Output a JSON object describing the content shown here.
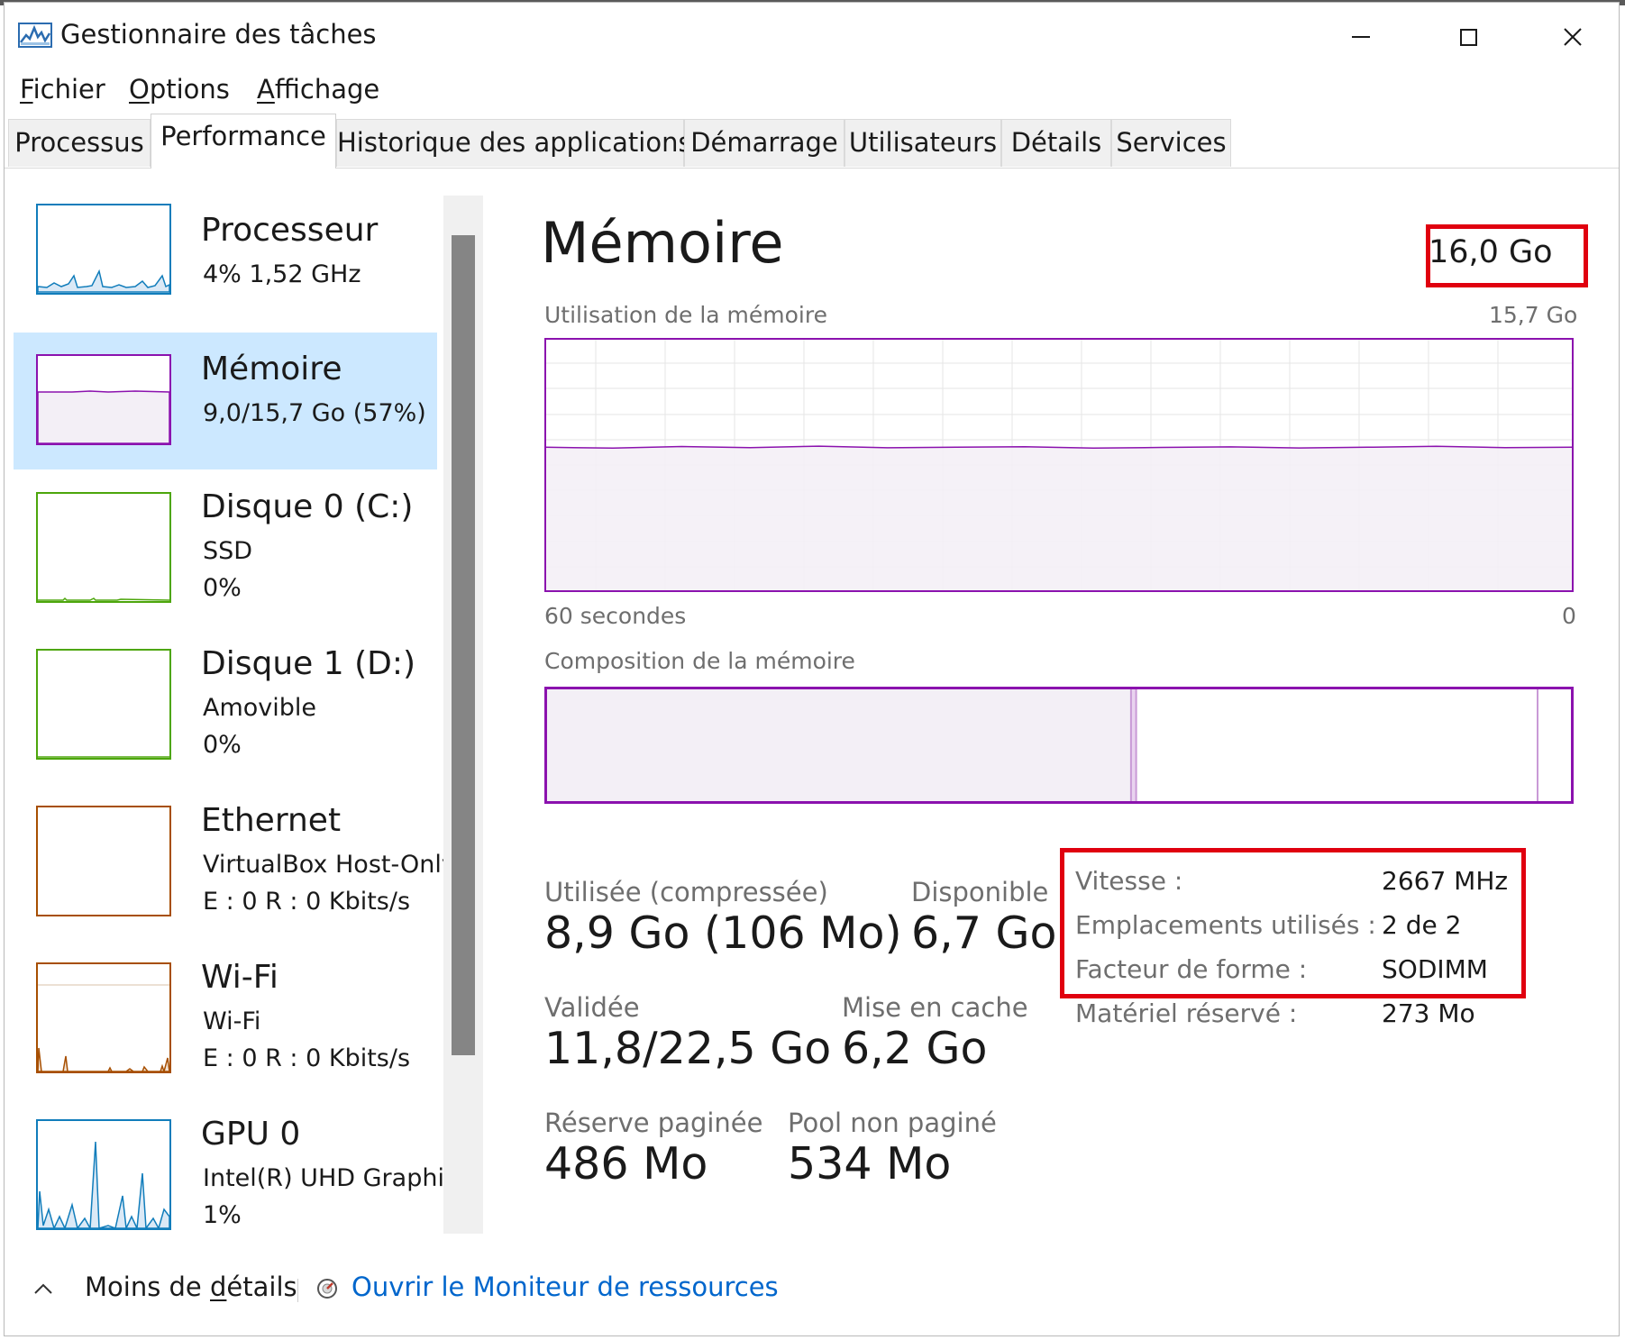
{
  "window": {
    "title": "Gestionnaire des tâches",
    "icon": "task-manager-icon",
    "controls": [
      "minimize-icon",
      "maximize-icon",
      "close-icon"
    ]
  },
  "menu": {
    "fichier": {
      "mnemonic": "F",
      "rest": "ichier"
    },
    "options": {
      "mnemonic": "O",
      "rest": "ptions"
    },
    "affichage": {
      "mnemonic": "A",
      "rest": "ffichage"
    }
  },
  "tabs": [
    "Processus",
    "Performance",
    "Historique des applications",
    "Démarrage",
    "Utilisateurs",
    "Détails",
    "Services"
  ],
  "active_tab": "Performance",
  "sidebar": {
    "items": [
      {
        "name": "Processeur",
        "line1": "4%  1,52 GHz",
        "line2": ""
      },
      {
        "name": "Mémoire",
        "line1": "9,0/15,7 Go (57%)",
        "line2": ""
      },
      {
        "name": "Disque 0 (C:)",
        "line1": "SSD",
        "line2": "0%"
      },
      {
        "name": "Disque 1 (D:)",
        "line1": "Amovible",
        "line2": "0%"
      },
      {
        "name": "Ethernet",
        "line1": "VirtualBox Host-Only",
        "line2": "E : 0  R : 0 Kbits/s"
      },
      {
        "name": "Wi-Fi",
        "line1": "Wi-Fi",
        "line2": "E : 0  R : 0 Kbits/s"
      },
      {
        "name": "GPU 0",
        "line1": "Intel(R) UHD Graphics",
        "line2": "1%"
      }
    ],
    "selected_index": 1
  },
  "main": {
    "title": "Mémoire",
    "total": "16,0 Go",
    "usage_caption": "Utilisation de la mémoire",
    "usage_max": "15,7 Go",
    "time_left": "60 secondes",
    "time_right": "0",
    "composition_caption": "Composition de la mémoire",
    "stats": {
      "used_label": "Utilisée (compressée)",
      "used_value": "8,9 Go (106 Mo)",
      "available_label": "Disponible",
      "available_value": "6,7 Go",
      "committed_label": "Validée",
      "committed_value": "11,8/22,5 Go",
      "cached_label": "Mise en cache",
      "cached_value": "6,2 Go",
      "paged_label": "Réserve paginée",
      "paged_value": "486 Mo",
      "nonpaged_label": "Pool non paginé",
      "nonpaged_value": "534 Mo"
    },
    "specs": [
      {
        "label": "Vitesse :",
        "value": "2667 MHz"
      },
      {
        "label": "Emplacements utilisés :",
        "value": "2 de 2"
      },
      {
        "label": "Facteur de forme :",
        "value": "SODIMM"
      },
      {
        "label": "Matériel réservé :",
        "value": "273 Mo"
      }
    ]
  },
  "footer": {
    "less_details_pre": "Moins de ",
    "less_details_mnemonic": "d",
    "less_details_post": "étails",
    "resmon_link": "Ouvrir le Moniteur de ressources"
  },
  "chart_data": {
    "type": "area",
    "title": "Utilisation de la mémoire",
    "xlabel": "",
    "ylabel": "",
    "x_range_labels": [
      "60 secondes",
      "0"
    ],
    "y_max_label": "15,7 Go",
    "usage_fraction": 0.57,
    "composition_fractions": {
      "in_use": 0.57,
      "modified": 0.005,
      "standby": 0.39,
      "free": 0.03
    }
  },
  "colors": {
    "memory": "#8b12ae",
    "memory_fill": "#f3eff6",
    "cpu": "#117dbb",
    "disk": "#4da60c",
    "ethernet": "#a74f01",
    "wifi": "#a74f01",
    "gpu": "#117dbb",
    "selected_bg": "#cce8ff",
    "highlight": "#e0000f",
    "link": "#0066cc"
  }
}
